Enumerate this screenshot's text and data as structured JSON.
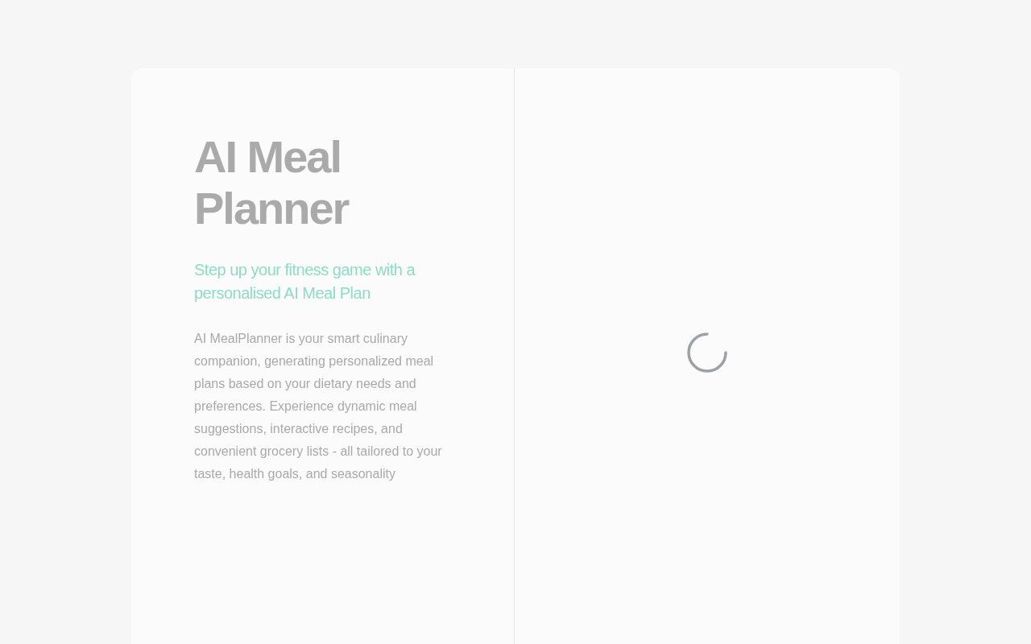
{
  "intro": {
    "title": "AI Meal Planner",
    "subtitle": "Step up your fitness game with a personalised AI Meal Plan",
    "description": "AI MealPlanner is your smart culinary companion, generating personalized meal plans based on your dietary needs and preferences. Experience dynamic meal suggestions, interactive recipes, and convenient grocery lists - all tailored to your taste, health goals, and seasonality"
  },
  "panel": {
    "loading": true
  }
}
